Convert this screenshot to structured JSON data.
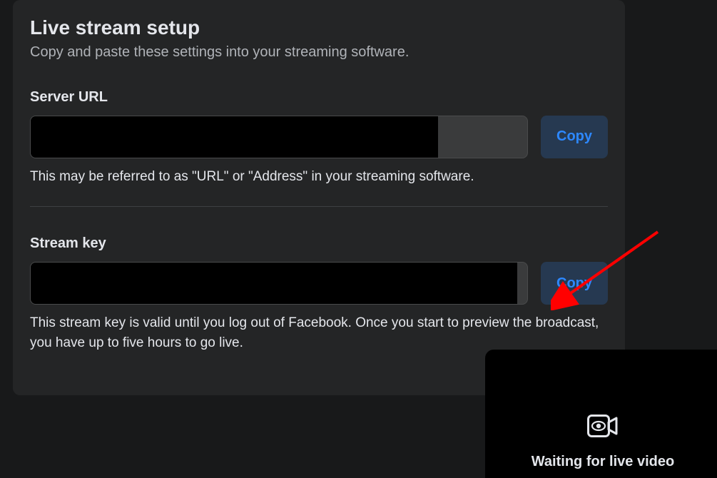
{
  "panel": {
    "title": "Live stream setup",
    "subtitle": "Copy and paste these settings into your streaming software."
  },
  "serverUrl": {
    "label": "Server URL",
    "copyLabel": "Copy",
    "help": "This may be referred to as \"URL\" or \"Address\" in your streaming software."
  },
  "streamKey": {
    "label": "Stream key",
    "copyLabel": "Copy",
    "help": "This stream key is valid until you log out of Facebook. Once you start to preview the broadcast, you have up to five hours to go live."
  },
  "preview": {
    "status": "Waiting for live video"
  }
}
